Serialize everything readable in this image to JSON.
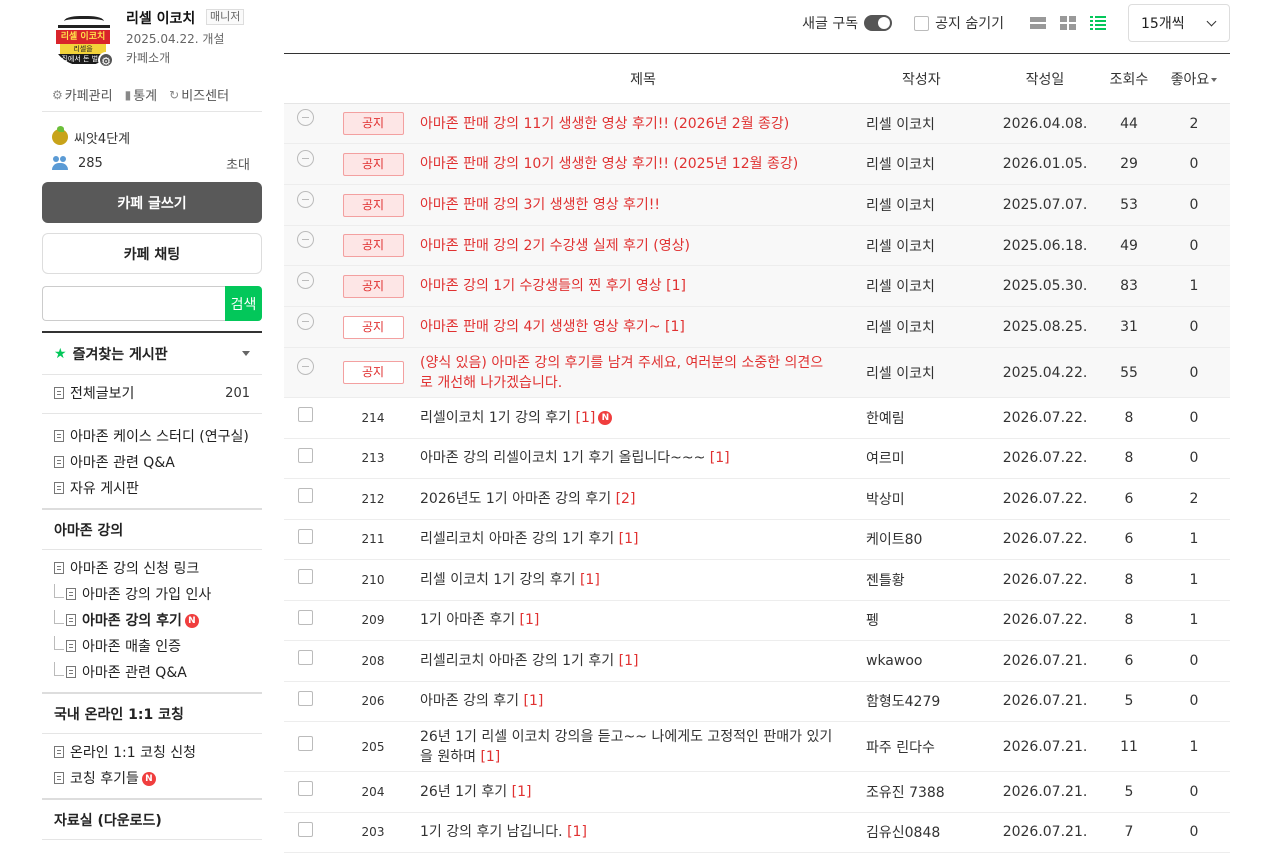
{
  "cafe": {
    "name": "리셀 이코치",
    "badge": "매니저",
    "founded": "2025.04.22. 개설",
    "intro": "카페소개",
    "logo": {
      "line1": "리셀 이코치",
      "line2": "리셀을",
      "line3": "집에서 돈 벌기"
    },
    "admin": {
      "manage": "카페관리",
      "stats": "통계",
      "biz": "비즈센터"
    },
    "level": "씨앗4단계",
    "members": "285",
    "invite": "초대",
    "write_label": "카페 글쓰기",
    "chat_label": "카페 채팅",
    "search_button": "검색",
    "search_placeholder": ""
  },
  "favorites": {
    "title": "즐겨찾는 게시판"
  },
  "menu": {
    "all_posts": {
      "label": "전체글보기",
      "count": "201"
    },
    "boards": [
      "아마존 케이스 스터디 (연구실)",
      "아마존 관련 Q&A",
      "자유 게시판"
    ],
    "group1": {
      "title": "아마존 강의",
      "items": [
        "아마존 강의 신청 링크",
        "아마존 강의 가입 인사",
        "아마존 강의 후기",
        "아마존 매출 인증",
        "아마존 관련 Q&A"
      ]
    },
    "group2": {
      "title": "국내 온라인 1:1 코칭",
      "items": [
        "온라인 1:1 코칭 신청",
        "코칭 후기들"
      ]
    },
    "group3": {
      "title": "자료실 (다운로드)"
    },
    "new_badge": "N"
  },
  "toolbar": {
    "subscribe": "새글 구독",
    "hide_notice": "공지 숨기기",
    "per_page": "15개씩"
  },
  "table": {
    "headers": {
      "title": "제목",
      "author": "작성자",
      "date": "작성일",
      "views": "조회수",
      "likes": "좋아요"
    },
    "notice_label": "공지",
    "notices": [
      {
        "title": "아마존 판매 강의 11기 생생한 영상 후기!! (2026년 2월 종강)",
        "comments": "",
        "author": "리셀 이코치",
        "date": "2026.04.08.",
        "views": "44",
        "likes": "2"
      },
      {
        "title": "아마존 판매 강의 10기 생생한 영상 후기!! (2025년 12월 종강)",
        "comments": "",
        "author": "리셀 이코치",
        "date": "2026.01.05.",
        "views": "29",
        "likes": "0"
      },
      {
        "title": "아마존 판매 강의 3기 생생한 영상 후기!!",
        "comments": "",
        "author": "리셀 이코치",
        "date": "2025.07.07.",
        "views": "53",
        "likes": "0"
      },
      {
        "title": "아마존 판매 강의 2기 수강생 실제 후기 (영상)",
        "comments": "",
        "author": "리셀 이코치",
        "date": "2025.06.18.",
        "views": "49",
        "likes": "0"
      },
      {
        "title": "아마존 강의 1기 수강생들의 찐 후기 영상",
        "comments": "[1]",
        "author": "리셀 이코치",
        "date": "2025.05.30.",
        "views": "83",
        "likes": "1"
      },
      {
        "title": "아마존 판매 강의 4기 생생한 영상 후기~",
        "comments": "[1]",
        "author": "리셀 이코치",
        "date": "2025.08.25.",
        "views": "31",
        "likes": "0"
      },
      {
        "title": "(양식 있음) 아마존 강의 후기를 남겨 주세요, 여러분의 소중한 의견으로 개선해 나가겠습니다.",
        "comments": "",
        "author": "리셀 이코치",
        "date": "2025.04.22.",
        "views": "55",
        "likes": "0"
      }
    ],
    "posts": [
      {
        "num": "214",
        "title": "리셀이코치 1기 강의 후기",
        "comments": "[1]",
        "new": "N",
        "author": "한예림",
        "date": "2026.07.22.",
        "views": "8",
        "likes": "0"
      },
      {
        "num": "213",
        "title": "아마존 강의 리셀이코치 1기 후기 올립니다~~~",
        "comments": "[1]",
        "new": "",
        "author": "여르미",
        "date": "2026.07.22.",
        "views": "8",
        "likes": "0"
      },
      {
        "num": "212",
        "title": "2026년도 1기 아마존 강의 후기",
        "comments": "[2]",
        "new": "",
        "author": "박상미",
        "date": "2026.07.22.",
        "views": "6",
        "likes": "2"
      },
      {
        "num": "211",
        "title": "리셀리코치 아마존 강의 1기 후기",
        "comments": "[1]",
        "new": "",
        "author": "케이트80",
        "date": "2026.07.22.",
        "views": "6",
        "likes": "1"
      },
      {
        "num": "210",
        "title": "리셀 이코치 1기 강의 후기",
        "comments": "[1]",
        "new": "",
        "author": "젠틀황",
        "date": "2026.07.22.",
        "views": "8",
        "likes": "1"
      },
      {
        "num": "209",
        "title": "1기 아마존 후기",
        "comments": "[1]",
        "new": "",
        "author": "펭",
        "date": "2026.07.22.",
        "views": "8",
        "likes": "1"
      },
      {
        "num": "208",
        "title": "리셀리코치 아마존 강의 1기 후기",
        "comments": "[1]",
        "new": "",
        "author": "wkawoo",
        "date": "2026.07.21.",
        "views": "6",
        "likes": "0"
      },
      {
        "num": "206",
        "title": "아마존 강의 후기",
        "comments": "[1]",
        "new": "",
        "author": "함형도4279",
        "date": "2026.07.21.",
        "views": "5",
        "likes": "0"
      },
      {
        "num": "205",
        "title": "26년 1기 리셀 이코치 강의을 듣고~~ 나에게도 고정적인 판매가 있기을 원하며",
        "comments": "[1]",
        "new": "",
        "author": "파주 린다수",
        "date": "2026.07.21.",
        "views": "11",
        "likes": "1"
      },
      {
        "num": "204",
        "title": "26년 1기 후기",
        "comments": "[1]",
        "new": "",
        "author": "조유진 7388",
        "date": "2026.07.21.",
        "views": "5",
        "likes": "0"
      },
      {
        "num": "203",
        "title": "1기 강의 후기 남깁니다.",
        "comments": "[1]",
        "new": "",
        "author": "김유신0848",
        "date": "2026.07.21.",
        "views": "7",
        "likes": "0"
      }
    ]
  }
}
